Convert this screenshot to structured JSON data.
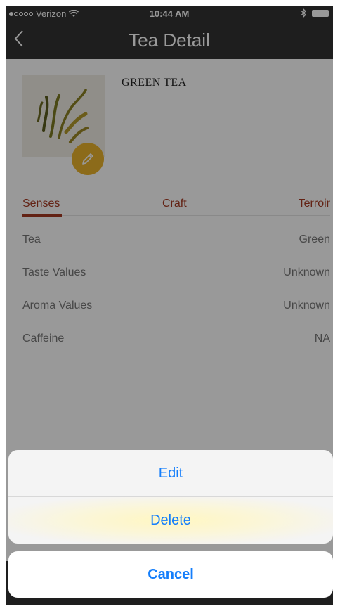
{
  "status_bar": {
    "carrier": "Verizon",
    "time": "10:44 AM",
    "signal_filled": 1,
    "signal_total": 5
  },
  "nav": {
    "title": "Tea Detail",
    "back_icon": "chevron-left-icon"
  },
  "tea": {
    "name": "GREEN TEA",
    "image_icon": "tea-leaves-image",
    "edit_icon": "pencil-icon"
  },
  "tabs": [
    {
      "label": "Senses",
      "selected": true
    },
    {
      "label": "Craft",
      "selected": false
    },
    {
      "label": "Terroir",
      "selected": false
    }
  ],
  "details": [
    {
      "label": "Tea",
      "value": "Green"
    },
    {
      "label": "Taste Values",
      "value": "Unknown"
    },
    {
      "label": "Aroma Values",
      "value": "Unknown"
    },
    {
      "label": "Caffeine",
      "value": "NA"
    }
  ],
  "action_sheet": {
    "edit_label": "Edit",
    "delete_label": "Delete",
    "cancel_label": "Cancel"
  },
  "colors": {
    "accent": "#a63a22",
    "nav_bg": "#333333",
    "badge": "#e9b22c",
    "ios_blue": "#147efb"
  }
}
